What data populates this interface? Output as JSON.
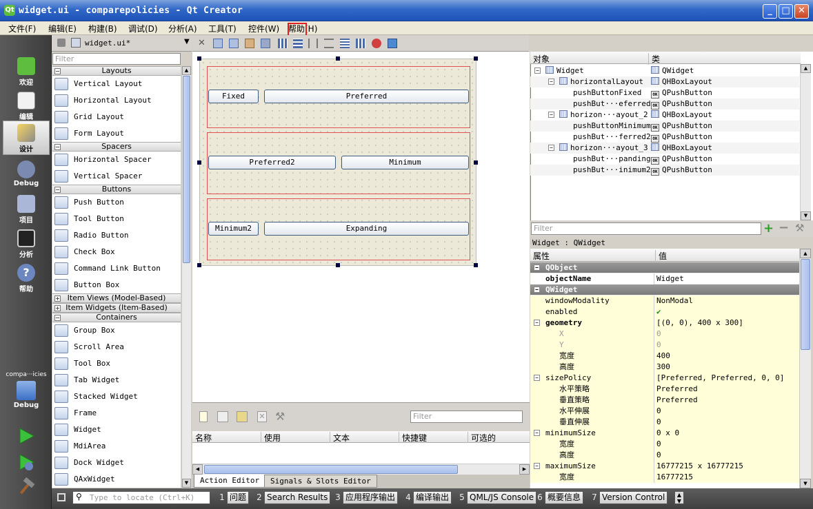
{
  "window": {
    "title": "widget.ui - comparepolicies - Qt Creator",
    "qt_logo": "Qt"
  },
  "menu": [
    "文件(F)",
    "编辑(E)",
    "构建(B)",
    "调试(D)",
    "分析(A)",
    "工具(T)",
    "控件(W)",
    "帮助(H)"
  ],
  "modes": [
    "欢迎",
    "编辑",
    "设计",
    "Debug",
    "项目",
    "分析",
    "帮助"
  ],
  "project_selector": {
    "name": "compa···icies",
    "mode": "Debug"
  },
  "editor_tab": {
    "file": "widget.ui*"
  },
  "widget_box": {
    "filter_placeholder": "Filter",
    "categories": [
      {
        "name": "Layouts",
        "expanded": true,
        "items": [
          "Vertical Layout",
          "Horizontal Layout",
          "Grid Layout",
          "Form Layout"
        ]
      },
      {
        "name": "Spacers",
        "expanded": true,
        "items": [
          "Horizontal Spacer",
          "Vertical Spacer"
        ]
      },
      {
        "name": "Buttons",
        "expanded": true,
        "items": [
          "Push Button",
          "Tool Button",
          "Radio Button",
          "Check Box",
          "Command Link Button",
          "Button Box"
        ]
      },
      {
        "name": "Item Views (Model-Based)",
        "expanded": false,
        "items": []
      },
      {
        "name": "Item Widgets (Item-Based)",
        "expanded": false,
        "items": []
      },
      {
        "name": "Containers",
        "expanded": true,
        "items": [
          "Group Box",
          "Scroll Area",
          "Tool Box",
          "Tab Widget",
          "Stacked Widget",
          "Frame",
          "Widget",
          "MdiArea",
          "Dock Widget",
          "QAxWidget"
        ]
      }
    ]
  },
  "form": {
    "rows": [
      {
        "buttons": [
          "Fixed",
          "Preferred"
        ]
      },
      {
        "buttons": [
          "Preferred2",
          "Minimum"
        ]
      },
      {
        "buttons": [
          "Minimum2",
          "Expanding"
        ]
      }
    ]
  },
  "action_editor": {
    "filter_placeholder": "Filter",
    "columns": [
      "名称",
      "使用",
      "文本",
      "快捷键",
      "可选的"
    ],
    "tabs": [
      "Action Editor",
      "Signals & Slots Editor"
    ],
    "active_tab": "Action Editor"
  },
  "object_inspector": {
    "columns": [
      "对象",
      "类"
    ],
    "rows": [
      {
        "object": "Widget",
        "class": "QWidget"
      },
      {
        "object": "horizontalLayout",
        "class": "QHBoxLayout"
      },
      {
        "object": "pushButtonFixed",
        "class": "QPushButton"
      },
      {
        "object": "pushBut···eferred",
        "class": "QPushButton"
      },
      {
        "object": "horizon···ayout_2",
        "class": "QHBoxLayout"
      },
      {
        "object": "pushButtonMinimum",
        "class": "QPushButton"
      },
      {
        "object": "pushBut···ferred2",
        "class": "QPushButton"
      },
      {
        "object": "horizon···ayout_3",
        "class": "QHBoxLayout"
      },
      {
        "object": "pushBut···panding",
        "class": "QPushButton"
      },
      {
        "object": "pushBut···inimum2",
        "class": "QPushButton"
      }
    ]
  },
  "property_editor": {
    "filter_placeholder": "Filter",
    "class_label": "Widget : QWidget",
    "columns": [
      "属性",
      "值"
    ],
    "rows": [
      {
        "key": "QObject",
        "value": "",
        "type": "group"
      },
      {
        "key": "objectName",
        "value": "Widget",
        "type": "bold"
      },
      {
        "key": "QWidget",
        "value": "",
        "type": "group"
      },
      {
        "key": "windowModality",
        "value": "NonModal",
        "type": "yel"
      },
      {
        "key": "enabled",
        "value": "✔",
        "type": "yel"
      },
      {
        "key": "geometry",
        "value": "[(0, 0), 400 x 300]",
        "type": "yelbold"
      },
      {
        "key": "X",
        "value": "0",
        "type": "sub-dim"
      },
      {
        "key": "Y",
        "value": "0",
        "type": "sub-dim"
      },
      {
        "key": "宽度",
        "value": "400",
        "type": "sub"
      },
      {
        "key": "高度",
        "value": "300",
        "type": "sub"
      },
      {
        "key": "sizePolicy",
        "value": "[Preferred, Preferred, 0, 0]",
        "type": "yel"
      },
      {
        "key": "水平策略",
        "value": "Preferred",
        "type": "sub"
      },
      {
        "key": "垂直策略",
        "value": "Preferred",
        "type": "sub"
      },
      {
        "key": "水平伸展",
        "value": "0",
        "type": "sub"
      },
      {
        "key": "垂直伸展",
        "value": "0",
        "type": "sub"
      },
      {
        "key": "minimumSize",
        "value": "0 x 0",
        "type": "yel"
      },
      {
        "key": "宽度",
        "value": "0",
        "type": "sub"
      },
      {
        "key": "高度",
        "value": "0",
        "type": "sub"
      },
      {
        "key": "maximumSize",
        "value": "16777215 x 16777215",
        "type": "yel"
      },
      {
        "key": "宽度",
        "value": "16777215",
        "type": "sub"
      }
    ]
  },
  "status_bar": {
    "locate_placeholder": "Type to locate (Ctrl+K)",
    "panes": [
      {
        "n": "1",
        "label": "问题"
      },
      {
        "n": "2",
        "label": "Search Results"
      },
      {
        "n": "3",
        "label": "应用程序输出"
      },
      {
        "n": "4",
        "label": "编译输出"
      },
      {
        "n": "5",
        "label": "QML/JS Console"
      },
      {
        "n": "6",
        "label": "概要信息"
      },
      {
        "n": "7",
        "label": "Version Control"
      }
    ]
  },
  "colors": {
    "accent": "#3168c7",
    "layout_border": "#e05050",
    "highlight": "#e02020",
    "qt_green": "#5ebd3e"
  }
}
